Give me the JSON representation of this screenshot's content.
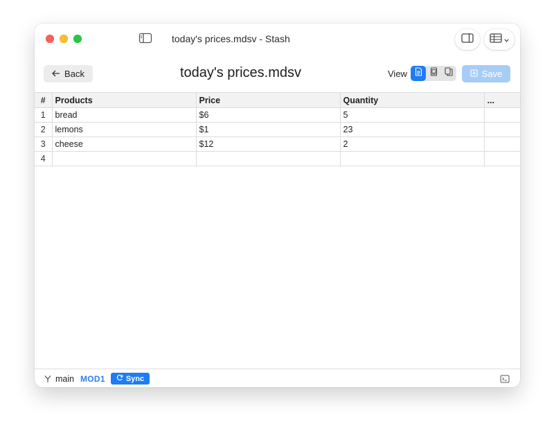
{
  "window": {
    "title": "today's prices.mdsv - Stash",
    "traffic_lights": [
      "close",
      "minimize",
      "zoom"
    ],
    "toolbar_icons": [
      "sidebar-toggle-icon",
      "inspector-toggle-icon",
      "table-menu-icon",
      "chevron-down-icon"
    ]
  },
  "toolbar": {
    "back_label": "Back",
    "doc_title": "today's prices.mdsv",
    "view_label": "View",
    "view_modes": [
      "text-view-icon",
      "preview-view-icon",
      "split-view-icon"
    ],
    "active_view": 0,
    "save_label": "Save",
    "save_enabled": false
  },
  "table": {
    "columns": [
      "#",
      "Products",
      "Price",
      "Quantity",
      "..."
    ],
    "rows": [
      {
        "num": "1",
        "product": "bread",
        "price": "$6",
        "quantity": "5",
        "extra": ""
      },
      {
        "num": "2",
        "product": "lemons",
        "price": "$1",
        "quantity": "23",
        "extra": ""
      },
      {
        "num": "3",
        "product": "cheese",
        "price": "$12",
        "quantity": "2",
        "extra": ""
      },
      {
        "num": "4",
        "product": "",
        "price": "",
        "quantity": "",
        "extra": ""
      }
    ]
  },
  "statusbar": {
    "branch": "main",
    "mod": "MOD1",
    "sync_label": "Sync"
  },
  "colors": {
    "accent": "#1f7cf5",
    "save_disabled": "#a7cdf7",
    "mod_text": "#2f80ed"
  }
}
